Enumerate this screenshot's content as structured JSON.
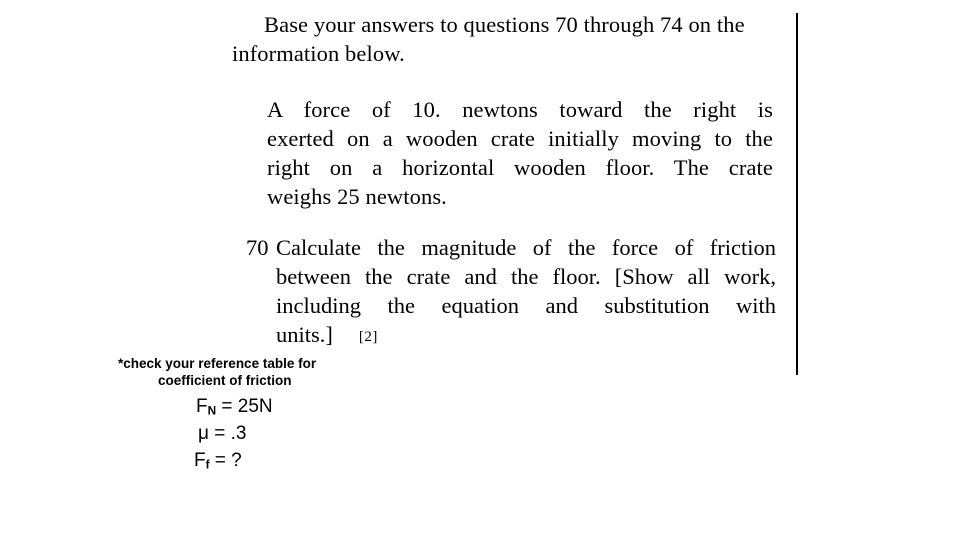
{
  "document": {
    "intro_paragraph": "Base your answers to questions 70 through 74 on the information below.",
    "body_paragraph": {
      "line1": "A  force  of  10.  newtons  toward  the  right  is",
      "line2": "exerted on a wooden crate initially moving to the",
      "line3": "right  on  a  horizontal  wooden  floor.  The  crate",
      "line4": "weighs 25 newtons.",
      "full_text": "A force of 10. newtons toward the right is exerted on a wooden crate initially moving to the right on a horizontal wooden floor. The crate weighs 25 newtons."
    },
    "question": {
      "number": "70",
      "line1": "Calculate the magnitude of the force of friction",
      "line2": "between the crate and the floor. [Show all work,",
      "line3": "including  the  equation  and  substitution  with",
      "line4": "units.]",
      "full_text": "Calculate the magnitude of the force of friction between the crate and the floor. [Show all work, including the equation and substitution with units.]",
      "credit": "[2]"
    }
  },
  "annotation": {
    "note_line_1": "*check your reference table for",
    "note_line_2": "coefficient of friction",
    "equations": [
      {
        "lhs": "F",
        "sub": "N",
        "rhs": " = 25N"
      },
      {
        "lhs": "μ",
        "sub": "",
        "rhs": " = .3"
      },
      {
        "lhs": "F",
        "sub": "f",
        "rhs": " = ?"
      }
    ]
  },
  "colors": {
    "background": "#ffffff",
    "text": "#000000",
    "rule": "#000000"
  }
}
